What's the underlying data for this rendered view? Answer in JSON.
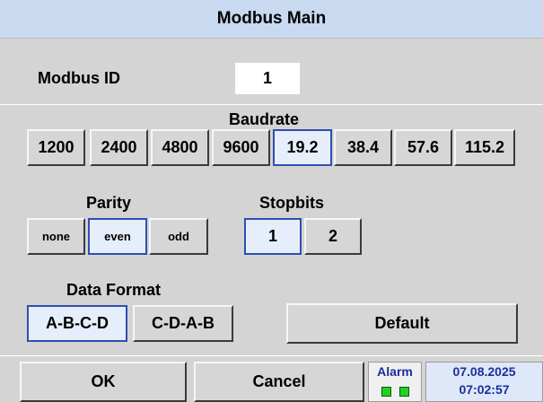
{
  "title": "Modbus Main",
  "modbus_id": {
    "label": "Modbus ID",
    "value": "1"
  },
  "baudrate": {
    "label": "Baudrate",
    "options": [
      "1200",
      "2400",
      "4800",
      "9600",
      "19.2",
      "38.4",
      "57.6",
      "115.2"
    ],
    "selected": "19.2"
  },
  "parity": {
    "label": "Parity",
    "options": [
      "none",
      "even",
      "odd"
    ],
    "selected": "even"
  },
  "stopbits": {
    "label": "Stopbits",
    "options": [
      "1",
      "2"
    ],
    "selected": "1"
  },
  "data_format": {
    "label": "Data Format",
    "options": [
      "A-B-C-D",
      "C-D-A-B"
    ],
    "selected": "A-B-C-D"
  },
  "buttons": {
    "default": "Default",
    "ok": "OK",
    "cancel": "Cancel"
  },
  "status": {
    "alarm_label": "Alarm",
    "alarm_led_color": "#22d022",
    "date": "07.08.2025",
    "time": "07:02:57"
  },
  "colors": {
    "title_bg": "#c8d9f0",
    "selected_bg": "#e6eefc",
    "selected_border": "#2d4fb0",
    "panel_bg": "#d4d4d4"
  }
}
